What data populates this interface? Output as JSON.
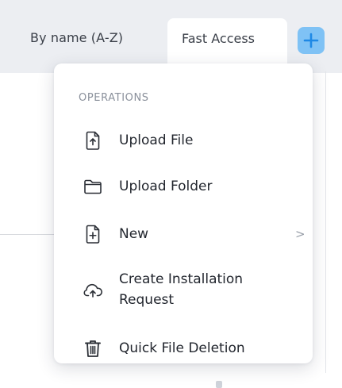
{
  "toolbar": {
    "sort_label": "By name (A-Z)",
    "fast_access_label": "Fast Access",
    "add_icon": "plus-icon"
  },
  "colors": {
    "accent": "#1e88e5",
    "add_button_bg": "#7fc2f5"
  },
  "menu": {
    "heading": "OPERATIONS",
    "items": [
      {
        "label": "Upload File",
        "icon": "upload-file-icon"
      },
      {
        "label": "Upload Folder",
        "icon": "folder-icon"
      },
      {
        "label": "New",
        "icon": "new-file-icon",
        "has_submenu": true,
        "chevron": ">"
      },
      {
        "label": "Create Installation Request",
        "icon": "cloud-upload-icon"
      },
      {
        "label": "Quick File Deletion",
        "icon": "trash-icon"
      }
    ]
  }
}
